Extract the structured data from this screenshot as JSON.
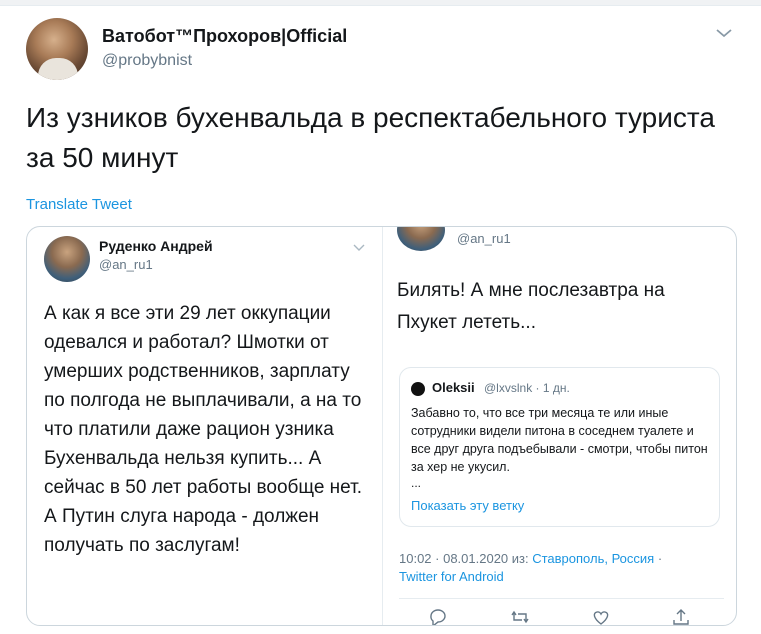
{
  "tweet": {
    "author_name": "Ватобот™Прохоров|Official",
    "author_handle": "@probybnist",
    "text": "Из узников бухенвальда в респектабельного туриста за 50 минут",
    "translate_label": "Translate Tweet"
  },
  "embedded": {
    "left": {
      "author_name": "Руденко Андрей",
      "author_handle": "@an_ru1",
      "text": "А как я все эти 29 лет оккупации одевался и работал? Шмотки от умерших родственников, зарплату по полгода не выплачивали, а на то что платили даже рацион узника Бухенвальда нельзя купить... А сейчас в 50 лет работы вообще нет. А Путин слуга народа - должен получать по заслугам!"
    },
    "right": {
      "author_handle": "@an_ru1",
      "text": "Билять! А мне послезавтра на Пхукет лететь...",
      "quote": {
        "author_name": "Oleksii",
        "meta": "@lxvslnk · 1 дн.",
        "text": "Забавно то, что все три месяца те или иные сотрудники видели питона в соседнем туалете и все друг друга подъебывали - смотри, чтобы питон за хер не укусил.",
        "ellipsis": "...",
        "show_thread": "Показать эту ветку"
      },
      "timestamp": "10:02 · 08.01.2020 из:",
      "location": "Ставрополь, Россия",
      "separator": "·",
      "client": "Twitter for Android",
      "actions": [
        "reply-icon",
        "retweet-icon",
        "like-icon",
        "share-icon"
      ]
    }
  },
  "colors": {
    "accent": "#1b95e0",
    "secondary_text": "#657786",
    "border": "#ccd6dd"
  }
}
